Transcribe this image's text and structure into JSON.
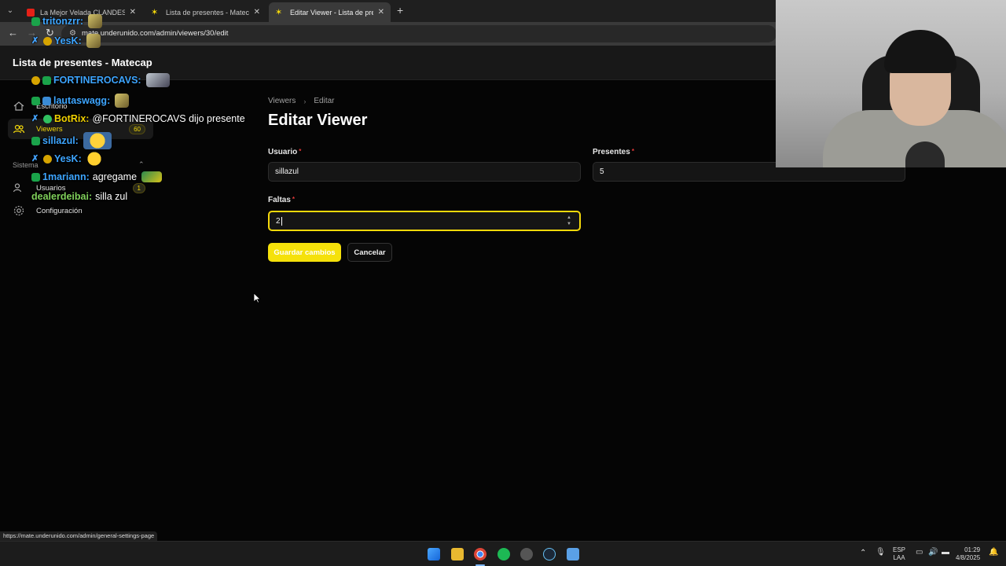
{
  "browser": {
    "tabs": [
      {
        "title": "La Mejor Velada CLANDESTINA",
        "active": false
      },
      {
        "title": "Lista de presentes - Matecap",
        "active": false
      },
      {
        "title": "Editar Viewer - Lista de presentes",
        "active": true
      }
    ],
    "url": "mate.underunido.com/admin/viewers/30/edit",
    "status_url": "https://mate.underunido.com/admin/general-settings-page"
  },
  "app": {
    "brand": "Lista de presentes - Matecap"
  },
  "sidebar": {
    "items": [
      {
        "label": "Escritorio",
        "icon": "home-icon"
      },
      {
        "label": "Viewers",
        "icon": "users-icon",
        "badge": "60",
        "active": true
      }
    ],
    "group": {
      "label": "Sistema",
      "items": [
        {
          "label": "Usuarios",
          "icon": "user-icon",
          "badge": "1"
        },
        {
          "label": "Configuración",
          "icon": "gear-icon"
        }
      ]
    }
  },
  "chat": [
    {
      "user": "tritonzrr:",
      "msg": ""
    },
    {
      "user": "YesK:",
      "msg": ""
    },
    {
      "user": "FORTINEROCAVS:",
      "msg": ""
    },
    {
      "user": "lautaswagg:",
      "msg": ""
    },
    {
      "user": "BotRix:",
      "msg": "@FORTINEROCAVS dijo presente"
    },
    {
      "user": "sillazul:",
      "msg": ""
    },
    {
      "user": "YesK:",
      "msg": ""
    },
    {
      "user": "1mariann:",
      "msg": "agregame"
    },
    {
      "user": "dealerdeibai:",
      "msg": "silla zul"
    }
  ],
  "main": {
    "breadcrumb": [
      "Viewers",
      "Editar"
    ],
    "title": "Editar Viewer",
    "fields": {
      "usuario": {
        "label": "Usuario",
        "value": "sillazul"
      },
      "presentes": {
        "label": "Presentes",
        "value": "5"
      },
      "faltas": {
        "label": "Faltas",
        "value": "2"
      }
    },
    "buttons": {
      "save": "Guardar cambios",
      "cancel": "Cancelar"
    }
  },
  "taskbar": {
    "lang": "ESP",
    "lang2": "LAA",
    "time": "01:29",
    "date": "4/8/2025"
  },
  "colors": {
    "accent": "#f5d90a",
    "required": "#e53b3b"
  }
}
